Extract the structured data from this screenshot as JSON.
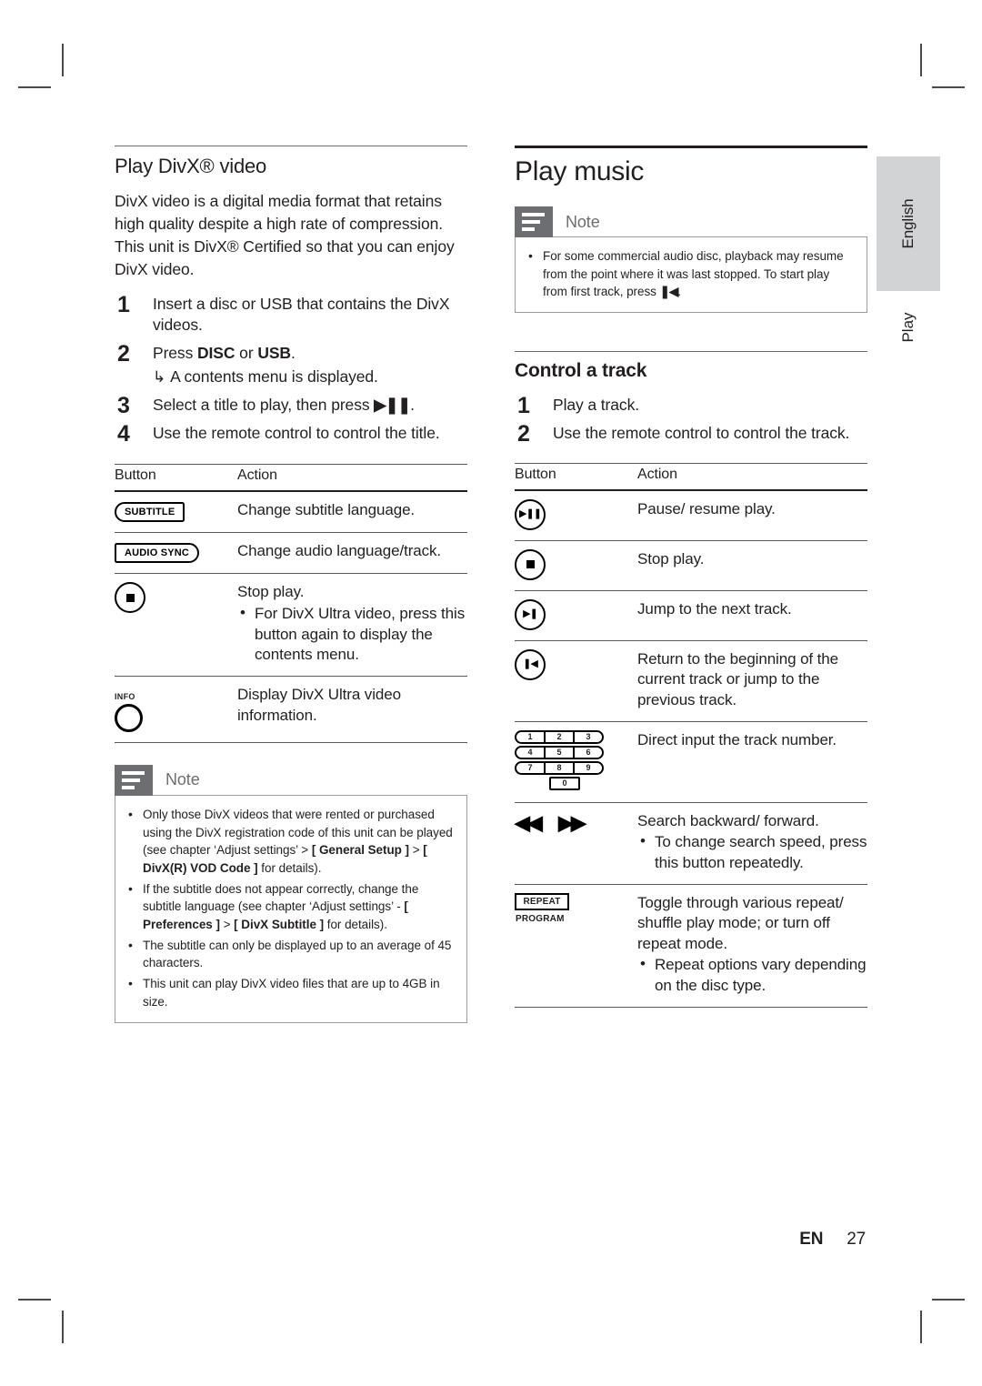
{
  "page": {
    "footer_lang": "EN",
    "footer_number": "27",
    "side_tab_language": "English",
    "side_tab_section": "Play"
  },
  "left": {
    "heading": "Play DivX® video",
    "intro": "DivX video is a digital media format that retains high quality despite a high rate of compression. This unit is DivX® Certified so that you can enjoy DivX video.",
    "steps": [
      {
        "text": "Insert a disc or USB that contains the DivX videos."
      },
      {
        "text_pre": "Press ",
        "bold1": "DISC",
        "text_mid": " or ",
        "bold2": "USB",
        "text_post": ".",
        "substep": "A contents menu is displayed."
      },
      {
        "text_pre": "Select a title to play, then press ",
        "glyph": "▶❚❚",
        "text_post": "."
      },
      {
        "text": "Use the remote control to control the title."
      }
    ],
    "table": {
      "header_button": "Button",
      "header_action": "Action",
      "rows": [
        {
          "button_type": "pill-round-left",
          "button_label": "SUBTITLE",
          "action": "Change subtitle language."
        },
        {
          "button_type": "pill-round-right",
          "button_label": "AUDIO SYNC",
          "action": "Change audio language/track."
        },
        {
          "button_type": "circle-stop",
          "button_label": "stop-icon",
          "action": "Stop play.",
          "sub": [
            "For DivX Ultra video, press this button again to display the contents menu."
          ]
        },
        {
          "button_type": "info-ring",
          "button_label": "INFO",
          "action": "Display DivX Ultra video information."
        }
      ]
    },
    "note": {
      "title": "Note",
      "items": [
        {
          "parts": [
            {
              "t": "Only those DivX videos that were rented or purchased using the DivX registration code of this unit can be played (see chapter ‘Adjust settings’ > ",
              "b": false
            },
            {
              "t": "[ General Setup ]",
              "b": true
            },
            {
              "t": " > ",
              "b": false
            },
            {
              "t": "[ DivX(R) VOD Code ]",
              "b": true
            },
            {
              "t": " for details).",
              "b": false
            }
          ]
        },
        {
          "parts": [
            {
              "t": "If the subtitle does not appear correctly, change the subtitle language (see chapter ‘Adjust settings’ - ",
              "b": false
            },
            {
              "t": "[ Preferences ]",
              "b": true
            },
            {
              "t": " > ",
              "b": false
            },
            {
              "t": "[ DivX Subtitle ]",
              "b": true
            },
            {
              "t": " for details).",
              "b": false
            }
          ]
        },
        {
          "parts": [
            {
              "t": "The subtitle can only be displayed up to an average of 45 characters.",
              "b": false
            }
          ]
        },
        {
          "parts": [
            {
              "t": "This unit can play DivX video files that are up to 4GB in size.",
              "b": false
            }
          ]
        }
      ]
    }
  },
  "right": {
    "heading": "Play music",
    "note": {
      "title": "Note",
      "items": [
        {
          "parts": [
            {
              "t": "For some commercial audio disc, playback may resume from the point where it was last stopped. To start play from first track, press ",
              "b": false
            },
            {
              "t": "❚◀",
              "b": false
            },
            {
              "t": ".",
              "b": false
            }
          ]
        }
      ]
    },
    "section_heading": "Control a track",
    "steps": [
      {
        "text": "Play a track."
      },
      {
        "text": "Use the remote control to control the track."
      }
    ],
    "table": {
      "header_button": "Button",
      "header_action": "Action",
      "rows": [
        {
          "button_type": "circle-playpause",
          "button_label": "play-pause-icon",
          "glyph": "▶❚❚",
          "action": "Pause/ resume play."
        },
        {
          "button_type": "circle-stop",
          "button_label": "stop-icon",
          "action": "Stop play."
        },
        {
          "button_type": "circle-next",
          "button_label": "next-track-icon",
          "glyph": "▶❚",
          "action": "Jump to the next track."
        },
        {
          "button_type": "circle-prev",
          "button_label": "previous-track-icon",
          "glyph": "❚◀",
          "action": "Return to the beginning of the current track or jump to the previous track."
        },
        {
          "button_type": "numpad",
          "button_label": "numeric-keypad",
          "keys": [
            [
              "1",
              "2",
              "3"
            ],
            [
              "4",
              "5",
              "6"
            ],
            [
              "7",
              "8",
              "9"
            ],
            [
              "0"
            ]
          ],
          "action": "Direct input the track number."
        },
        {
          "button_type": "search-arrows",
          "button_label": "search-backward-forward-icon",
          "glyph_back": "◀◀",
          "glyph_fwd": "▶▶",
          "action": "Search backward/ forward.",
          "sub": [
            "To change search speed, press this button repeatedly."
          ]
        },
        {
          "button_type": "repeat-program",
          "button_label": "REPEAT",
          "button_sublabel": "PROGRAM",
          "action": "Toggle through various repeat/ shuffle play mode; or turn off repeat mode.",
          "sub": [
            "Repeat options vary depending on the disc type."
          ]
        }
      ]
    }
  },
  "colors": {
    "text": "#231f20",
    "rule": "#58595b",
    "note_badge": "#6d6e71",
    "side_tab": "#d2d3d5"
  }
}
